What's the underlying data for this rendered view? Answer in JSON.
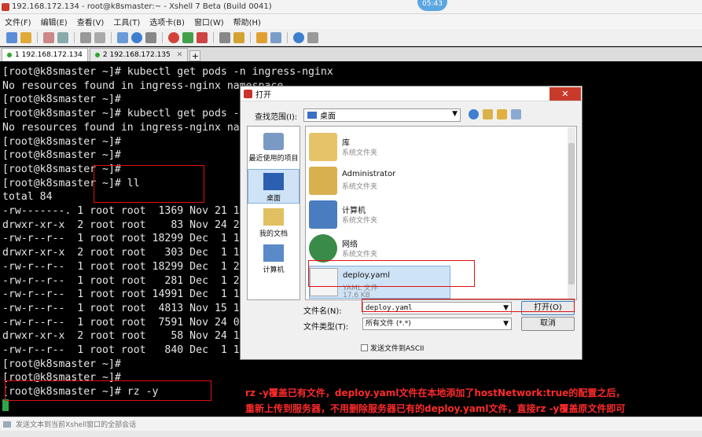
{
  "window": {
    "title": "192.168.172.134 - root@k8smaster:~ - Xshell 7 Beta (Build 0041)",
    "clock": "05:43"
  },
  "menu": [
    "文件(F)",
    "编辑(E)",
    "查看(V)",
    "工具(T)",
    "选项卡(B)",
    "窗口(W)",
    "帮助(H)"
  ],
  "tabs": [
    {
      "label": "1 192.168.172.134",
      "active": true
    },
    {
      "label": "2 192.168.172.135",
      "active": false
    }
  ],
  "terminal": {
    "lines": [
      "[root@k8smaster ~]# kubectl get pods -n ingress-nginx",
      "No resources found in ingress-nginx namespace.",
      "[root@k8smaster ~]#",
      "[root@k8smaster ~]# kubectl get pods -n ingress-nginx",
      "No resources found in ingress-nginx namespace.",
      "[root@k8smaster ~]#",
      "[root@k8smaster ~]#",
      "[root@k8smaster ~]#",
      "[root@k8smaster ~]# ll",
      "total 84",
      "-rw-------. 1 root root  1369 Nov 21 15",
      "drwxr-xr-x  2 root root    83 Nov 24 22",
      "-rw-r--r--  1 root root 18299 Dec  1 14",
      "drwxr-xr-x  2 root root   303 Dec  1 19",
      "-rw-r--r--  1 root root 18299 Dec  1 21",
      "-rw-r--r--  1 root root   281 Dec  1 21",
      "-rw-r--r--  1 root root 14991 Dec  1 16",
      "-rw-r--r--  1 root root  4813 Nov 15 16",
      "-rw-r--r--  1 root root  7591 Nov 24 01",
      "drwxr-xr-x  2 root root    58 Nov 24 16",
      "-rw-r--r--  1 root root   840 Dec  1 16",
      "[root@k8smaster ~]#",
      "[root@k8smaster ~]#",
      "[root@k8smaster ~]# rz -y"
    ]
  },
  "dialog": {
    "title": "打开",
    "close": "✕",
    "look_in_label": "查找范围(I):",
    "look_in_value": "桌面",
    "places": [
      "最近使用的项目",
      "桌面",
      "我的文档",
      "计算机"
    ],
    "files": [
      {
        "name": "库",
        "type": "系统文件夹",
        "size": ""
      },
      {
        "name": "Administrator",
        "type": "系统文件夹",
        "size": ""
      },
      {
        "name": "计算机",
        "type": "系统文件夹",
        "size": ""
      },
      {
        "name": "网络",
        "type": "系统文件夹",
        "size": ""
      },
      {
        "name": "deploy.yaml",
        "type": "YAML 文件",
        "size": "17.6 KB"
      }
    ],
    "filename_label": "文件名(N):",
    "filename_value": "deploy.yaml",
    "filetype_label": "文件类型(T):",
    "filetype_value": "所有文件 (*.*)",
    "open_button": "打开(O)",
    "cancel_button": "取消",
    "ascii_label": "发送文件到ASCII"
  },
  "annotation": {
    "line1": "rz -y覆盖已有文件，deploy.yaml文件在本地添加了hostNetwork:true的配置之后，",
    "line2": "重新上传到服务器，不用删除服务器已有的deploy.yaml文件，直接rz -y覆盖原文件即可"
  },
  "compose_bar": "发送文本到当前Xshell窗口的全部会话",
  "colors": {
    "highlight": "#e01010",
    "annotation": "#ff2a2a",
    "cursor": "#2da84a"
  }
}
